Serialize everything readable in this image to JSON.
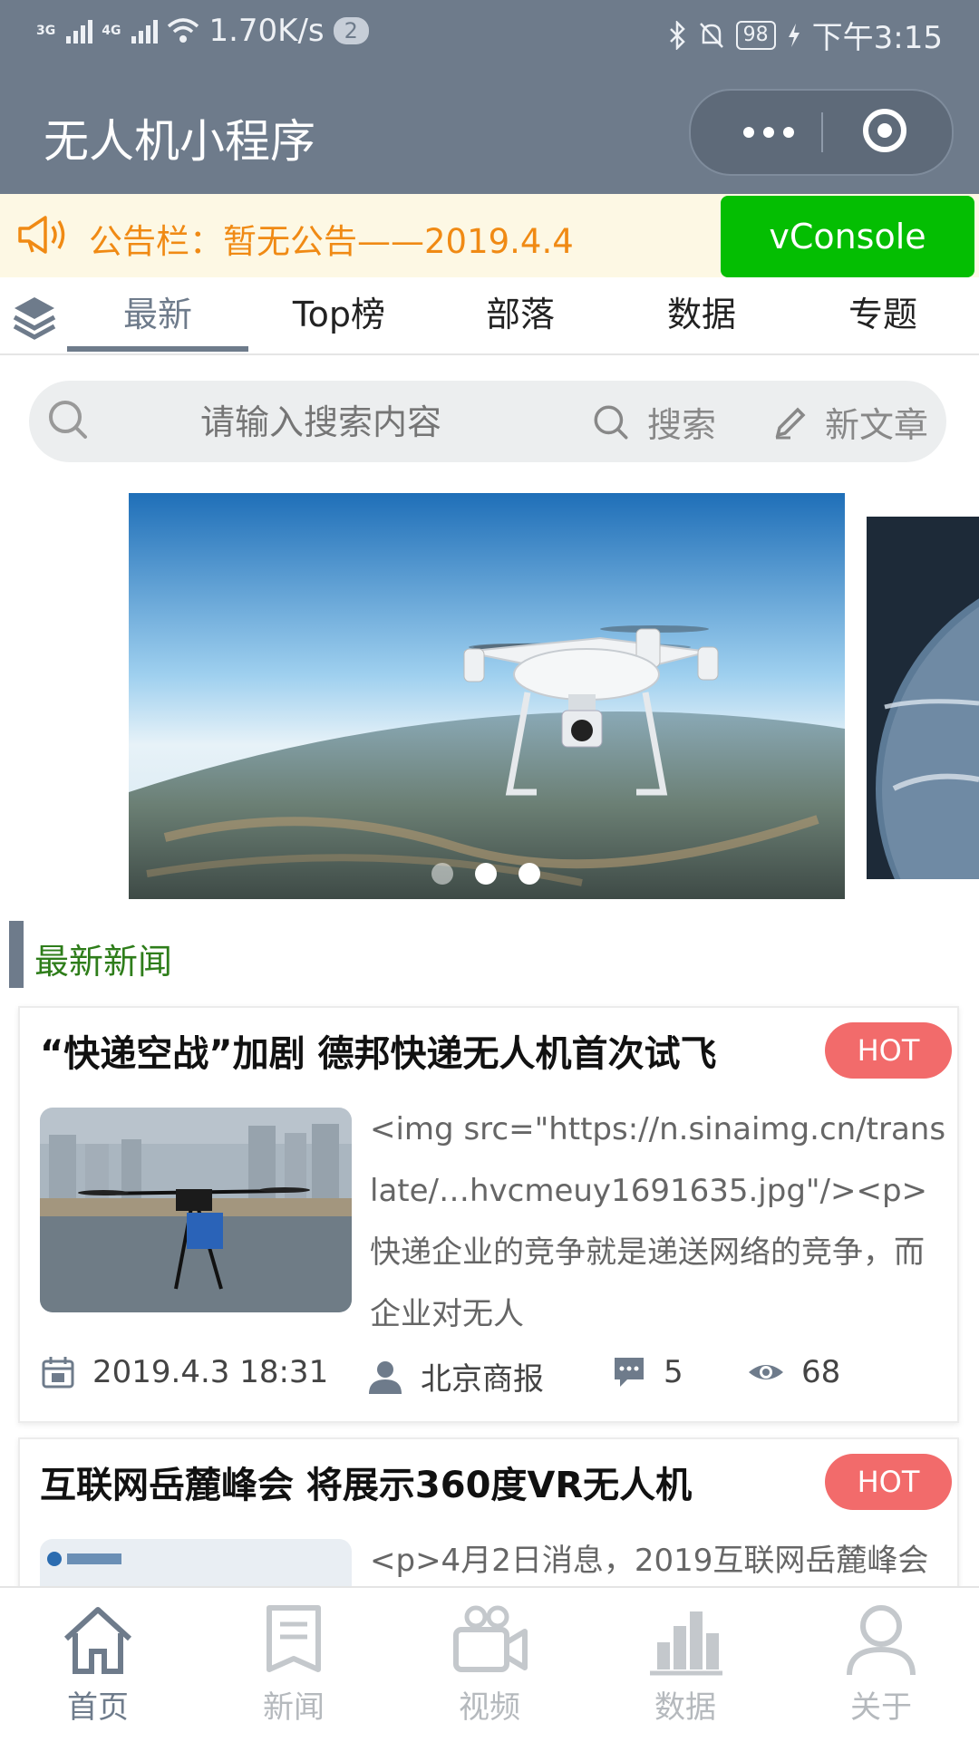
{
  "status_bar": {
    "network_1": "3G",
    "network_2": "4G",
    "speed": "1.70K/s",
    "notification_count": "2",
    "battery": "98",
    "time": "下午3:15"
  },
  "title_bar": {
    "title": "无人机小程序"
  },
  "notice": {
    "text": "公告栏：暂无公告——2019.4.4",
    "vconsole_label": "vConsole"
  },
  "tabs": [
    {
      "label": "最新",
      "active": true
    },
    {
      "label": "Top榜",
      "active": false
    },
    {
      "label": "部落",
      "active": false
    },
    {
      "label": "数据",
      "active": false
    },
    {
      "label": "专题",
      "active": false
    }
  ],
  "search": {
    "placeholder": "请输入搜索内容",
    "search_label": "搜索",
    "new_article_label": "新文章"
  },
  "carousel": {
    "dot_count": 3,
    "active_dot": 1
  },
  "section": {
    "title": "最新新闻"
  },
  "articles": [
    {
      "title": "“快递空战”加剧 德邦快递无人机首次试飞",
      "badge": "HOT",
      "excerpt": "<img src=\"https://n.sinaimg.cn/translate/…hvcmeuy1691635.jpg\"/><p>快递企业的竞争就是递送网络的竞争，而企业对无人",
      "date": "2019.4.3 18:31",
      "author": "北京商报",
      "comments": "5",
      "views": "68"
    },
    {
      "title": "互联网岳麓峰会 将展示360度VR无人机",
      "badge": "HOT",
      "excerpt": "<p>4月2日消息，2019互联网岳麓峰会"
    }
  ],
  "bottom_nav": [
    {
      "label": "首页",
      "icon": "home-icon",
      "active": true
    },
    {
      "label": "新闻",
      "icon": "news-icon",
      "active": false
    },
    {
      "label": "视频",
      "icon": "video-icon",
      "active": false
    },
    {
      "label": "数据",
      "icon": "chart-icon",
      "active": false
    },
    {
      "label": "关于",
      "icon": "user-icon",
      "active": false
    }
  ],
  "colors": {
    "nav": "#6e7b8b",
    "notice_text": "#f08a14",
    "vconsole": "#04be02",
    "hot": "#f26b6b",
    "section_title": "#2e7d1a"
  }
}
